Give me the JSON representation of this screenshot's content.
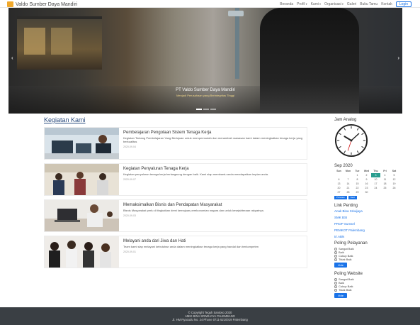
{
  "brand": {
    "name": "Valdo Sumber Daya Mandiri"
  },
  "nav": {
    "items": [
      "Beranda",
      "Profil",
      "Kami",
      "Organisasi",
      "Galeri",
      "Buku Tamu",
      "Kontak"
    ],
    "login": "Login"
  },
  "hero": {
    "title": "PT Valdo Sumber Daya Mandiri",
    "subtitle": "Menjadi Perusahaan yang Berintegritas Tinggi"
  },
  "section": {
    "title": "Kegiatan Kami"
  },
  "cards": [
    {
      "title": "Pembelajaran Pengolaan Sistem Tenaga Kerja",
      "text": "Kegiatan Tentang Pembelajaran Yang Bertujuan untuk mempermudah dan menambah wawasan kami dalam meningkatkan tenaga kerja yang berkualitas",
      "date": "2020-09-04"
    },
    {
      "title": "Kegiatan Penyaluran Tenaga Kerja",
      "text": "Kegiatan penyaluran tenaga kerja berlangsung dengan baik. Kami siap membantu anda mendapatkan impian anda.",
      "date": "2020-09-07"
    },
    {
      "title": "Memaksimalkan Bisnis dan Pendapatan Masyarakat",
      "text": "Bisnis Masyarakat perlu di tingkatkan demi kemajuan perekonomian negara dan untuk kesejahteraan rakyatnya.",
      "date": "2020-09-03"
    },
    {
      "title": "Melayani anda dari Jiwa dan Hati",
      "text": "Team kami siap melayani kebutuhan anda dalam meningkatkan tenaga kerja yang handal dan berkompeten",
      "date": "2020-09-01"
    }
  ],
  "sidebar": {
    "clock_title": "Jam Analog",
    "calendar": {
      "month": "Sep 2020",
      "days": [
        "Sun",
        "Mon",
        "Tue",
        "Wed",
        "Thu",
        "Fri",
        "Sat"
      ],
      "weeks": [
        [
          "",
          "",
          "1",
          "2",
          "3",
          "4",
          "5"
        ],
        [
          "6",
          "7",
          "8",
          "9",
          "10",
          "11",
          "12"
        ],
        [
          "13",
          "14",
          "15",
          "16",
          "17",
          "18",
          "19"
        ],
        [
          "20",
          "21",
          "22",
          "23",
          "24",
          "25",
          "26"
        ],
        [
          "27",
          "28",
          "29",
          "30",
          "",
          "",
          ""
        ]
      ],
      "today": "3",
      "prev": "Previous",
      "next": "Next"
    },
    "links_title": "Link Penting",
    "links": [
      "Anak Bina Sriwijaya",
      "SMK BSI",
      "PROP Sumsel",
      "PEMKOT Palembang",
      "tri.ABN"
    ],
    "poll1": {
      "title": "Poling Pelayanan",
      "options": [
        "Sangat Baik",
        "Baik",
        "Cukup Baik",
        "Tidak Baik"
      ],
      "button": "Vote"
    },
    "poll2": {
      "title": "Poling Website",
      "options": [
        "Sangat Baik",
        "Baik",
        "Cukup Baik",
        "Tidak Baik"
      ],
      "button": "Vote"
    }
  },
  "footer": {
    "line1": "© Copyright Teguh Santoso 2020",
    "line2": "AMIK BINA SRIWIJAYA PALEMBANG",
    "line3": "Jl. HM Ryacudu No. 24 Phone 0711-5210019 Palembang"
  }
}
